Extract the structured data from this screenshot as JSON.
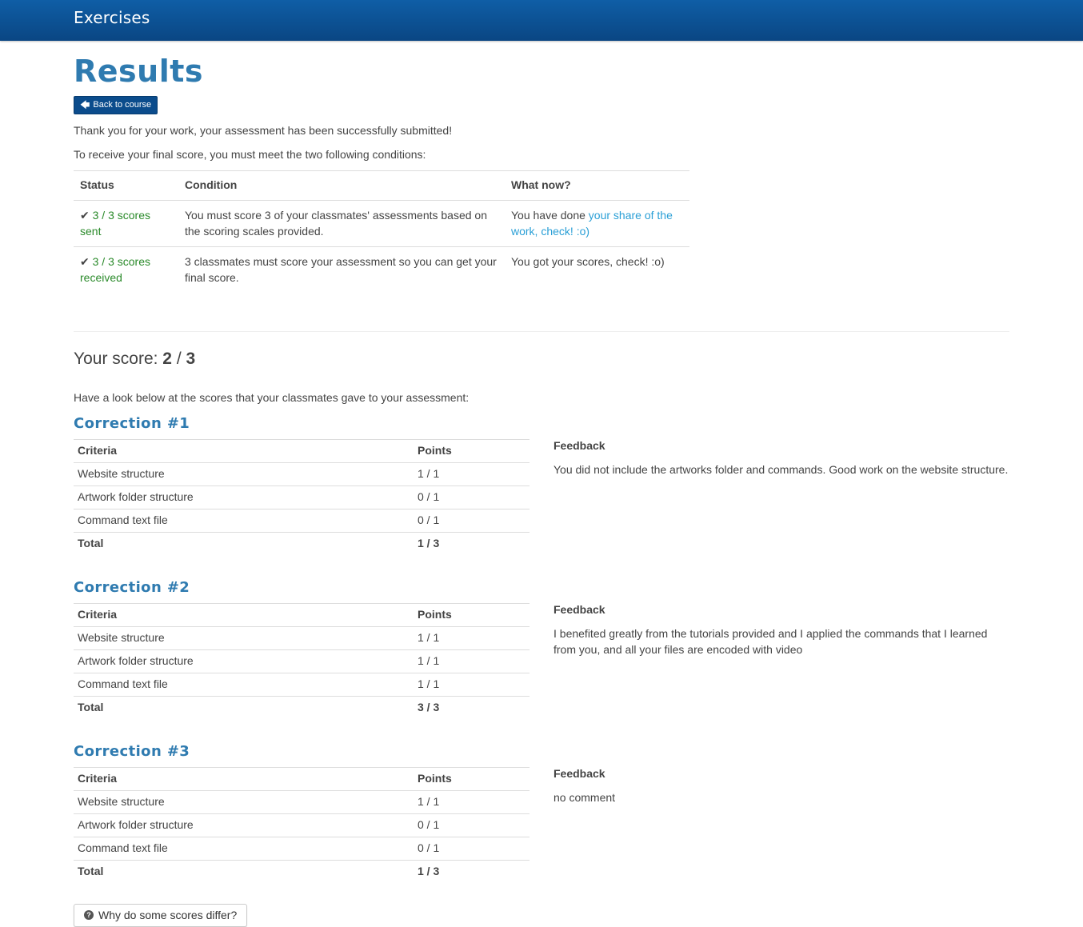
{
  "header": {
    "title": "Exercises"
  },
  "page": {
    "title": "Results",
    "back_label": "Back to course",
    "thanks": "Thank you for your work, your assessment has been successfully submitted!",
    "conditions_intro": "To receive your final score, you must meet the two following conditions:"
  },
  "conditions": {
    "headers": {
      "status": "Status",
      "condition": "Condition",
      "what_now": "What now?"
    },
    "rows": [
      {
        "status": "3 / 3 scores sent",
        "condition": "You must score 3 of your classmates' assessments based on the scoring scales provided.",
        "what_now_prefix": "You have done ",
        "what_now_link": "your share of the work, check! :o)"
      },
      {
        "status": "3 / 3 scores received",
        "condition": "3 classmates must score your assessment so you can get your final score.",
        "what_now_prefix": "You got your scores, check! :o)",
        "what_now_link": ""
      }
    ]
  },
  "score": {
    "label": "Your score:",
    "value": "2",
    "sep": "/",
    "max": "3"
  },
  "corrections_intro": "Have a look below at the scores that your classmates gave to your assessment:",
  "table_headers": {
    "criteria": "Criteria",
    "points": "Points",
    "feedback": "Feedback",
    "total": "Total"
  },
  "corrections": [
    {
      "title": "Correction #1",
      "rows": [
        {
          "criteria": "Website structure",
          "points": "1 / 1"
        },
        {
          "criteria": "Artwork folder structure",
          "points": "0 / 1"
        },
        {
          "criteria": "Command text file",
          "points": "0 / 1"
        }
      ],
      "total": "1 / 3",
      "feedback": "You did not include the artworks folder and commands. Good work on the website structure."
    },
    {
      "title": "Correction #2",
      "rows": [
        {
          "criteria": "Website structure",
          "points": "1 / 1"
        },
        {
          "criteria": "Artwork folder structure",
          "points": "1 / 1"
        },
        {
          "criteria": "Command text file",
          "points": "1 / 1"
        }
      ],
      "total": "3 / 3",
      "feedback": "I benefited greatly from the tutorials provided and I applied the commands that I learned from you, and all your files are encoded with video"
    },
    {
      "title": "Correction #3",
      "rows": [
        {
          "criteria": "Website structure",
          "points": "1 / 1"
        },
        {
          "criteria": "Artwork folder structure",
          "points": "0 / 1"
        },
        {
          "criteria": "Command text file",
          "points": "0 / 1"
        }
      ],
      "total": "1 / 3",
      "feedback": "no comment"
    }
  ],
  "why_button": "Why do some scores differ?",
  "colors": {
    "topbar": "#0a4683",
    "accent": "#2f7bb0",
    "ok": "#2a8a2a",
    "link": "#2a9fd6"
  }
}
